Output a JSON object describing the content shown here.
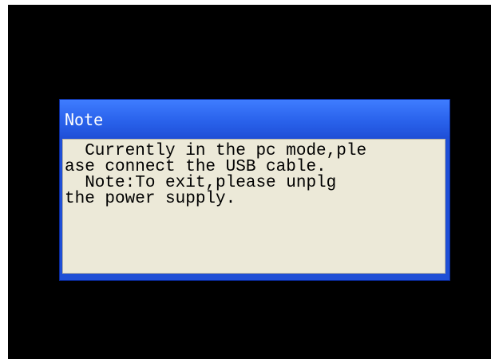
{
  "dialog": {
    "title": "Note",
    "message_lines": [
      "  Currently in the pc mode,ple",
      "ase connect the USB cable.",
      "  Note:To exit,please unplg",
      "the power supply."
    ]
  },
  "colors": {
    "screen_background": "#000000",
    "titlebar": "#2a63ec",
    "body_background": "#ece9d8"
  }
}
